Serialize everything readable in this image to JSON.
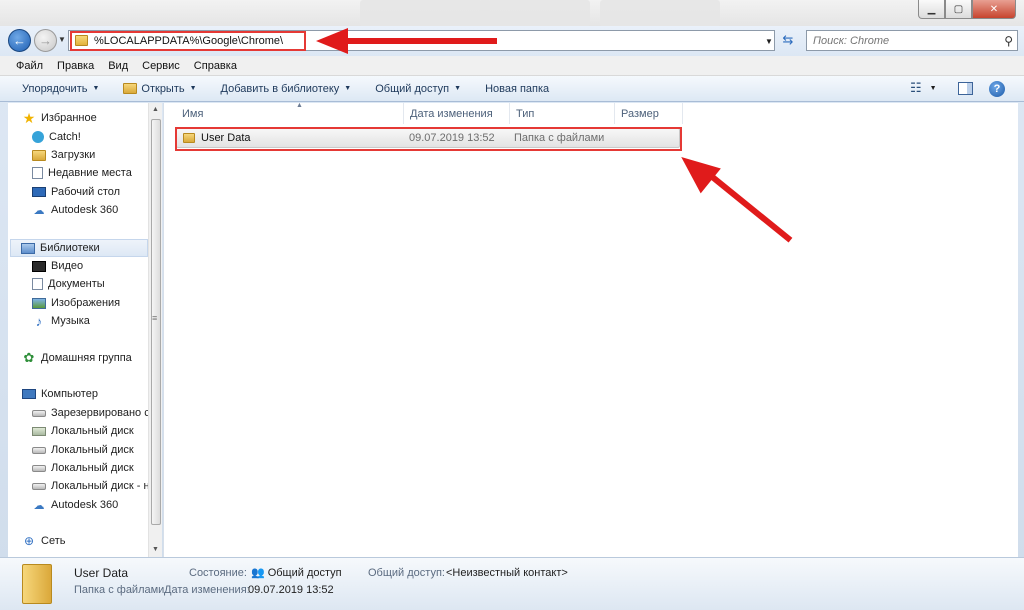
{
  "window": {
    "controls": {
      "minimize": "▁",
      "maximize": "▢",
      "close": "✕"
    }
  },
  "address": {
    "path": "%LOCALAPPDATA%\\Google\\Chrome\\",
    "back_icon": "←",
    "forward_icon": "→",
    "refresh_icon": "⇆"
  },
  "search": {
    "placeholder": "Поиск: Chrome",
    "icon": "magnifier-icon"
  },
  "menubar": {
    "items": [
      "Файл",
      "Правка",
      "Вид",
      "Сервис",
      "Справка"
    ]
  },
  "commandbar": {
    "organize": "Упорядочить",
    "open": "Открыть",
    "add_to_library": "Добавить в библиотеку",
    "share": "Общий доступ",
    "new_folder": "Новая папка",
    "help": "?"
  },
  "navpane": {
    "favorites": {
      "label": "Избранное",
      "items": [
        "Catch!",
        "Загрузки",
        "Недавние места",
        "Рабочий стол",
        "Autodesk 360"
      ]
    },
    "libraries": {
      "label": "Библиотеки",
      "items": [
        "Видео",
        "Документы",
        "Изображения",
        "Музыка"
      ]
    },
    "homegroup": "Домашняя группа",
    "computer": {
      "label": "Компьютер",
      "items": [
        "Зарезервировано си",
        "Локальный диск",
        "Локальный диск",
        "Локальный диск",
        "Локальный диск - н",
        "Autodesk 360"
      ]
    },
    "network": "Сеть"
  },
  "filelist": {
    "columns": [
      "Имя",
      "Дата изменения",
      "Тип",
      "Размер"
    ],
    "rows": [
      {
        "name": "User Data",
        "date": "09.07.2019 13:52",
        "type": "Папка с файлами",
        "size": ""
      }
    ]
  },
  "details": {
    "name": "User Data",
    "type": "Папка с файлами",
    "state_label": "Состояние:",
    "state_value": "Общий доступ",
    "modified_label": "Дата изменения:",
    "modified_value": "09.07.2019 13:52",
    "share_label": "Общий доступ:",
    "share_value": "<Неизвестный контакт>"
  },
  "colors": {
    "annotation_red": "#e53935",
    "accent": "#1e395b"
  }
}
